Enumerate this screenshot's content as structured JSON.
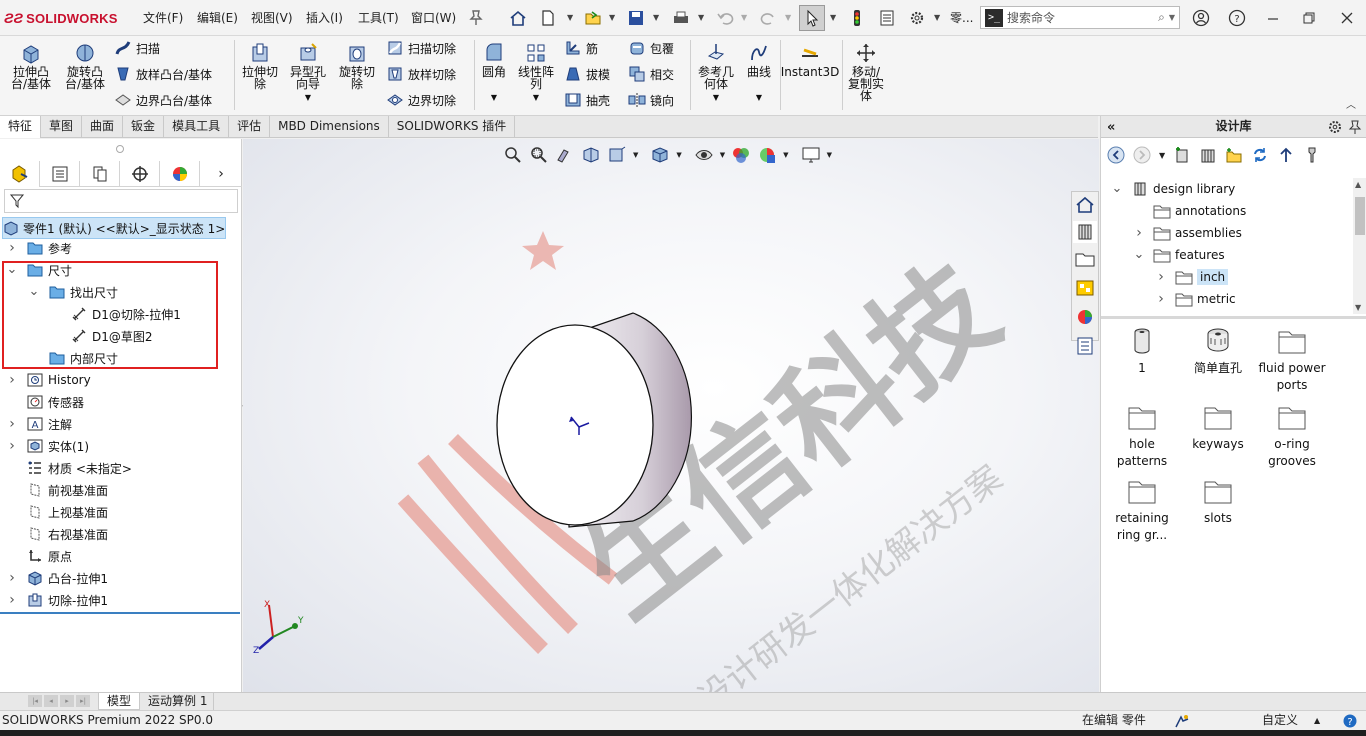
{
  "app": {
    "brand": "SOLIDWORKS"
  },
  "menus": [
    "文件(F)",
    "编辑(E)",
    "视图(V)",
    "插入(I)",
    "工具(T)",
    "窗口(W)"
  ],
  "titlebar": {
    "doc_label": "零...",
    "search_placeholder": "搜索命令"
  },
  "ribbon": {
    "extrude_boss": "拉伸凸\n台/基体",
    "revolve_boss": "旋转凸\n台/基体",
    "sweep": "扫描",
    "loft_boss": "放样凸台/基体",
    "boundary_boss": "边界凸台/基体",
    "extrude_cut": "拉伸切\n除",
    "hole_wizard": "异型孔\n向导",
    "revolve_cut": "旋转切\n除",
    "swept_cut": "扫描切除",
    "lofted_cut": "放样切除",
    "boundary_cut": "边界切除",
    "fillet": "圆角",
    "linear_pattern": "线性阵\n列",
    "rib": "筋",
    "draft": "拔模",
    "shell": "抽壳",
    "wrap": "包覆",
    "intersect": "相交",
    "mirror": "镜向",
    "ref_geometry": "参考几\n何体",
    "curves": "曲线",
    "instant3d": "Instant3D",
    "move_copy": "移动/\n复制实\n体"
  },
  "tabs": [
    "特征",
    "草图",
    "曲面",
    "钣金",
    "模具工具",
    "评估",
    "MBD Dimensions",
    "SOLIDWORKS 插件"
  ],
  "tree": {
    "root": "零件1 (默认) <<默认>_显示状态 1>",
    "items": [
      {
        "label": "参考",
        "level": 0,
        "twisty": "▶",
        "icon": "folder-icon"
      },
      {
        "label": "尺寸",
        "level": 0,
        "twisty": "▼",
        "icon": "folder-icon"
      },
      {
        "label": "找出尺寸",
        "level": 1,
        "twisty": "▼",
        "icon": "folder-icon"
      },
      {
        "label": "D1@切除-拉伸1",
        "level": 2,
        "twisty": "",
        "icon": "dimension-icon"
      },
      {
        "label": "D1@草图2",
        "level": 2,
        "twisty": "",
        "icon": "dimension-icon"
      },
      {
        "label": "内部尺寸",
        "level": 1,
        "twisty": "",
        "icon": "folder-icon"
      },
      {
        "label": "History",
        "level": 0,
        "twisty": "▶",
        "icon": "history-icon"
      },
      {
        "label": "传感器",
        "level": 0,
        "twisty": "",
        "icon": "sensor-icon"
      },
      {
        "label": "注解",
        "level": 0,
        "twisty": "▶",
        "icon": "annotation-icon"
      },
      {
        "label": "实体(1)",
        "level": 0,
        "twisty": "▶",
        "icon": "solid-body-icon"
      },
      {
        "label": "材质 <未指定>",
        "level": 0,
        "twisty": "",
        "icon": "material-icon"
      },
      {
        "label": "前视基准面",
        "level": 0,
        "twisty": "",
        "icon": "plane-icon"
      },
      {
        "label": "上视基准面",
        "level": 0,
        "twisty": "",
        "icon": "plane-icon"
      },
      {
        "label": "右视基准面",
        "level": 0,
        "twisty": "",
        "icon": "plane-icon"
      },
      {
        "label": "原点",
        "level": 0,
        "twisty": "",
        "icon": "origin-icon"
      },
      {
        "label": "凸台-拉伸1",
        "level": 0,
        "twisty": "▶",
        "icon": "boss-extrude-icon"
      },
      {
        "label": "切除-拉伸1",
        "level": 0,
        "twisty": "▶",
        "icon": "cut-extrude-icon"
      }
    ]
  },
  "watermark": {
    "main": "生信科技",
    "sub": "产品设计研发一体化解决方案"
  },
  "triad": {
    "x": "X",
    "y": "Y",
    "z": "Z"
  },
  "design_library": {
    "title": "设计库",
    "tree": [
      {
        "label": "design library",
        "twisty": "▼",
        "level": 0
      },
      {
        "label": "annotations",
        "twisty": "",
        "level": 1
      },
      {
        "label": "assemblies",
        "twisty": "▶",
        "level": 1
      },
      {
        "label": "features",
        "twisty": "▼",
        "level": 1
      },
      {
        "label": "inch",
        "twisty": "▶",
        "level": 2,
        "selected": true
      },
      {
        "label": "metric",
        "twisty": "▶",
        "level": 2
      }
    ],
    "items": [
      {
        "label": "1",
        "icon": "part-icon"
      },
      {
        "label": "简单直孔",
        "icon": "hole-part-icon"
      },
      {
        "label": "fluid power ports",
        "icon": "folder-icon"
      },
      {
        "label": "hole patterns",
        "icon": "folder-icon"
      },
      {
        "label": "keyways",
        "icon": "folder-icon"
      },
      {
        "label": "o-ring grooves",
        "icon": "folder-icon"
      },
      {
        "label": "retaining ring gr...",
        "icon": "folder-icon"
      },
      {
        "label": "slots",
        "icon": "folder-icon"
      }
    ]
  },
  "bottom_tabs": [
    "模型",
    "运动算例 1"
  ],
  "status": {
    "product": "SOLIDWORKS Premium 2022 SP0.0",
    "editing": "在编辑 零件",
    "units": "自定义"
  },
  "colors": {
    "brand_red": "#c8102e",
    "highlight_box": "#e02020",
    "selection_blue": "#cce4f7",
    "folder_blue": "#2c7fc9"
  }
}
